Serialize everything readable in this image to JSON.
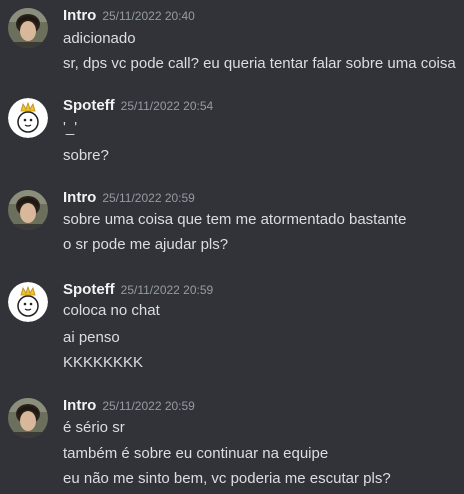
{
  "messages": [
    {
      "author": "Intro",
      "timestamp": "25/11/2022 20:40",
      "avatar_icon": "user-photo-avatar",
      "lines": [
        "adicionado",
        "sr, dps vc pode call? eu queria tentar falar sobre uma coisa"
      ]
    },
    {
      "author": "Spoteff",
      "timestamp": "25/11/2022 20:54",
      "avatar_icon": "crowned-snowman-avatar",
      "lines": [
        "'_'",
        "sobre?"
      ]
    },
    {
      "author": "Intro",
      "timestamp": "25/11/2022 20:59",
      "avatar_icon": "user-photo-avatar",
      "lines": [
        "sobre uma coisa que tem me atormentado bastante",
        "o sr pode me ajudar pls?"
      ]
    },
    {
      "author": "Spoteff",
      "timestamp": "25/11/2022 20:59",
      "avatar_icon": "crowned-snowman-avatar",
      "lines": [
        "coloca no chat",
        "ai penso",
        "KKKKKKKK"
      ]
    },
    {
      "author": "Intro",
      "timestamp": "25/11/2022 20:59",
      "avatar_icon": "user-photo-avatar",
      "lines": [
        "é sério sr",
        "também é sobre eu continuar na equipe",
        "eu não me sinto bem, vc poderia me escutar pls?"
      ]
    }
  ],
  "colors": {
    "background": "#313338",
    "username": "#f2f3f5",
    "timestamp": "#949ba4",
    "message_text": "#dbdee1"
  }
}
